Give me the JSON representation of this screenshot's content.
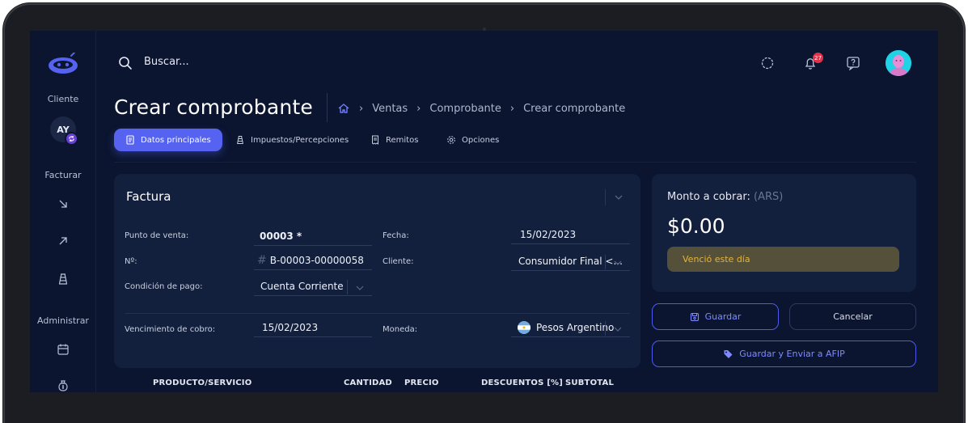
{
  "sidebar": {
    "section_cliente": "Cliente",
    "client_initials": "AY",
    "section_facturar": "Facturar",
    "section_administrar": "Administrar",
    "icons": [
      "arrow-down-right-icon",
      "arrow-up-right-icon",
      "tower-icon",
      "calendar-icon",
      "money-bag-icon"
    ]
  },
  "topbar": {
    "search_placeholder": "Buscar...",
    "notifications_count": "27"
  },
  "page": {
    "title": "Crear comprobante",
    "breadcrumb": [
      "Ventas",
      "Comprobante",
      "Crear comprobante"
    ]
  },
  "tabs": [
    {
      "label": "Datos principales",
      "active": true
    },
    {
      "label": "Impuestos/Percepciones",
      "active": false
    },
    {
      "label": "Remitos",
      "active": false
    },
    {
      "label": "Opciones",
      "active": false
    }
  ],
  "invoice": {
    "title": "Factura",
    "punto_venta_label": "Punto de venta:",
    "punto_venta_value": "00003 *",
    "numero_label": "Nº:",
    "numero_value": "B-00003-00000058",
    "condicion_label": "Condición de pago:",
    "condicion_value": "Cuenta Corriente",
    "fecha_label": "Fecha:",
    "fecha_value": "15/02/2023",
    "cliente_label": "Cliente:",
    "cliente_value": "Consumidor Final <...",
    "vencimiento_label": "Vencimiento de cobro:",
    "vencimiento_value": "15/02/2023",
    "moneda_label": "Moneda:",
    "moneda_value": "Pesos Argentino"
  },
  "amount": {
    "label": "Monto a cobrar:",
    "currency": "(ARS)",
    "value": "$0.00",
    "status": "Venció este día"
  },
  "buttons": {
    "save": "Guardar",
    "cancel": "Cancelar",
    "save_afip": "Guardar y Enviar a AFIP"
  },
  "table": {
    "columns": [
      "PRODUCTO/SERVICIO",
      "CANTIDAD",
      "PRECIO",
      "DESCUENTOS [%]",
      "SUBTOTAL"
    ]
  },
  "colors": {
    "background": "#0b1530",
    "card": "#13203d",
    "accent": "#5563f0",
    "warning_text": "#e3b43b",
    "notification": "#e0324b"
  }
}
